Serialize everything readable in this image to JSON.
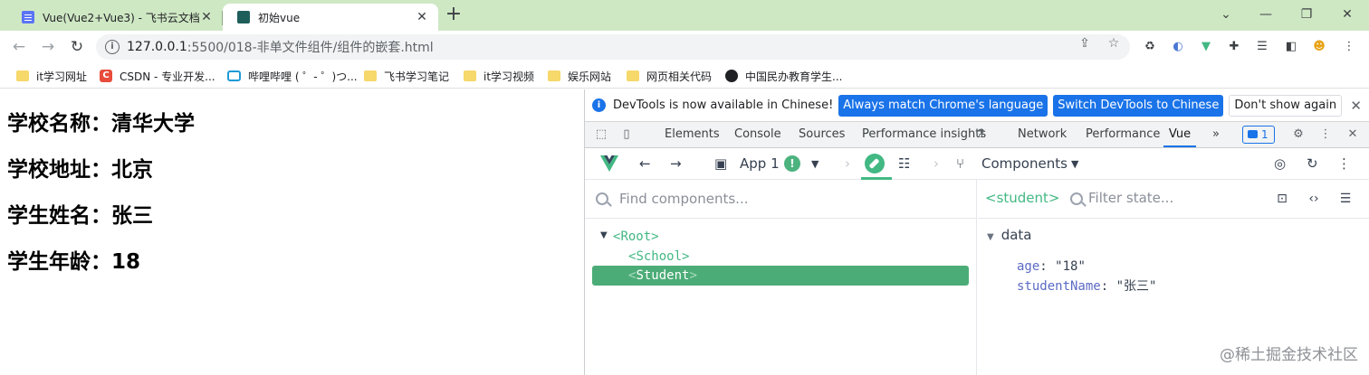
{
  "browser": {
    "tabs": [
      {
        "title": "Vue(Vue2+Vue3) - 飞书云文档",
        "active": false
      },
      {
        "title": "初始vue",
        "active": true
      }
    ],
    "new_tab": "+",
    "url": {
      "host": "127.0.0.1",
      "rest": ":5500/018-非单文件组件/组件的嵌套.html"
    },
    "bookmarks": [
      {
        "label": "it学习网址",
        "icon": "folder-icon"
      },
      {
        "label": "CSDN - 专业开发...",
        "icon": "csdn-icon"
      },
      {
        "label": "哔哩哔哩 ( ゜- ゜)つ...",
        "icon": "bilibili-icon"
      },
      {
        "label": "飞书学习笔记",
        "icon": "folder-icon"
      },
      {
        "label": "it学习视频",
        "icon": "folder-icon"
      },
      {
        "label": "娱乐网站",
        "icon": "folder-icon"
      },
      {
        "label": "网页相关代码",
        "icon": "folder-icon"
      },
      {
        "label": "中国民办教育学生...",
        "icon": "globe-icon"
      }
    ]
  },
  "page": {
    "lines": [
      "学校名称：清华大学",
      "学校地址：北京",
      "学生姓名：张三",
      "学生年龄：18"
    ]
  },
  "devtools": {
    "infobar": {
      "message": "DevTools is now available in Chinese!",
      "btn_match": "Always match Chrome's language",
      "btn_switch": "Switch DevTools to Chinese",
      "btn_dismiss": "Don't show again"
    },
    "tabs": [
      "Elements",
      "Console",
      "Sources",
      "Performance insights",
      "Network",
      "Performance",
      "Vue"
    ],
    "active_tab": "Vue",
    "more": "»",
    "issues_count": "1",
    "vue": {
      "app_label": "App 1",
      "warning": "!",
      "components_label": "Components",
      "search_placeholder": "Find components...",
      "tree": [
        {
          "name": "Root",
          "depth": 0,
          "expanded": true,
          "selected": false
        },
        {
          "name": "School",
          "depth": 1,
          "expanded": false,
          "selected": false
        },
        {
          "name": "Student",
          "depth": 1,
          "expanded": false,
          "selected": true
        }
      ],
      "selected_component": "<student>",
      "filter_placeholder": "Filter state...",
      "state_section": "data",
      "state": [
        {
          "key": "age",
          "value": "\"18\""
        },
        {
          "key": "studentName",
          "value": "\"张三\""
        }
      ]
    }
  },
  "watermark": "@稀土掘金技术社区",
  "colors": {
    "vue_green": "#42b883",
    "selected_row": "#4cac77",
    "chrome_tabstrip": "#cfe8c4",
    "devtools_blue": "#1a73e8"
  }
}
